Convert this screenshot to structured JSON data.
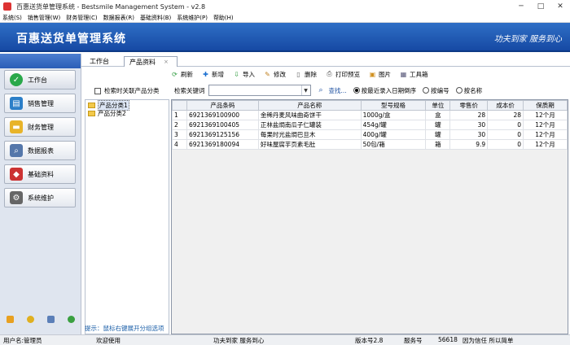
{
  "window": {
    "title": "百惠送货单管理系统 - Bestsmile Management System - v2.8",
    "minimize": "─",
    "maximize": "□",
    "close": "✕"
  },
  "menu": [
    "系统(S)",
    "销售管理(W)",
    "财务管理(C)",
    "数据报表(R)",
    "基础资料(B)",
    "系统维护(P)",
    "帮助(H)"
  ],
  "banner": {
    "logo": "百惠送货单管理系统",
    "slogan": "功夫到家 服务到心"
  },
  "nav": [
    {
      "label": "工作台",
      "icon": "checkmark-icon",
      "color": "#2aa84a"
    },
    {
      "label": "销售管理",
      "icon": "monitor-icon",
      "color": "#2c7fc8"
    },
    {
      "label": "财务管理",
      "icon": "folder-icon",
      "color": "#e8b42a"
    },
    {
      "label": "数据报表",
      "icon": "magnifier-icon",
      "color": "#5577aa"
    },
    {
      "label": "基础资料",
      "icon": "shapes-icon",
      "color": "#cc3333"
    },
    {
      "label": "系统维护",
      "icon": "gear-icon",
      "color": "#666666"
    }
  ],
  "tabs": [
    {
      "label": "工作台"
    },
    {
      "label": "产品资料"
    }
  ],
  "tab_close": "×",
  "left": {
    "checkbox_label": "检索时关联产品分类",
    "tree": [
      "产品分类1",
      "产品分类2"
    ],
    "hint": "提示：鼠标右键展开分组选项"
  },
  "toolbar": [
    "刷新",
    "新增",
    "导入",
    "修改",
    "删除",
    "打印预览",
    "图片",
    "工具箱"
  ],
  "search": {
    "label": "检索关键词",
    "button": "查找...",
    "options": [
      "按最近录入日期倒序",
      "按编号",
      "按名称"
    ],
    "selected": 0
  },
  "table": {
    "headers": [
      "",
      "产品条码",
      "产品名称",
      "型号规格",
      "单位",
      "零售价",
      "成本价",
      "保质期"
    ],
    "rows": [
      [
        "1",
        "6921369100900",
        "金稀丹麦风味曲奇饼干",
        "1000g/盒",
        "盒",
        "28",
        "28",
        "12个月"
      ],
      [
        "2",
        "6921369100405",
        "正林盐焗南瓜子仁罐装",
        "454g/罐",
        "罐",
        "30",
        "0",
        "12个月"
      ],
      [
        "3",
        "6921369125156",
        "每果时光盐焗巴旦木",
        "400g/罐",
        "罐",
        "30",
        "0",
        "12个月"
      ],
      [
        "4",
        "6921369180094",
        "好味屋腐芋页素毛肚",
        "50包/箱",
        "箱",
        "9.9",
        "0",
        "12个月"
      ]
    ]
  },
  "status": {
    "user": "用户名:管理员",
    "welcome": "欢迎使用",
    "motto": "功夫到家 服务到心",
    "version": "版本号2.8",
    "service": "服务号",
    "service_no": "56618",
    "trust": "因为信任 所以简单"
  },
  "colors": {
    "banner": "#1f5bb5",
    "accent": "#1b5fa8"
  }
}
